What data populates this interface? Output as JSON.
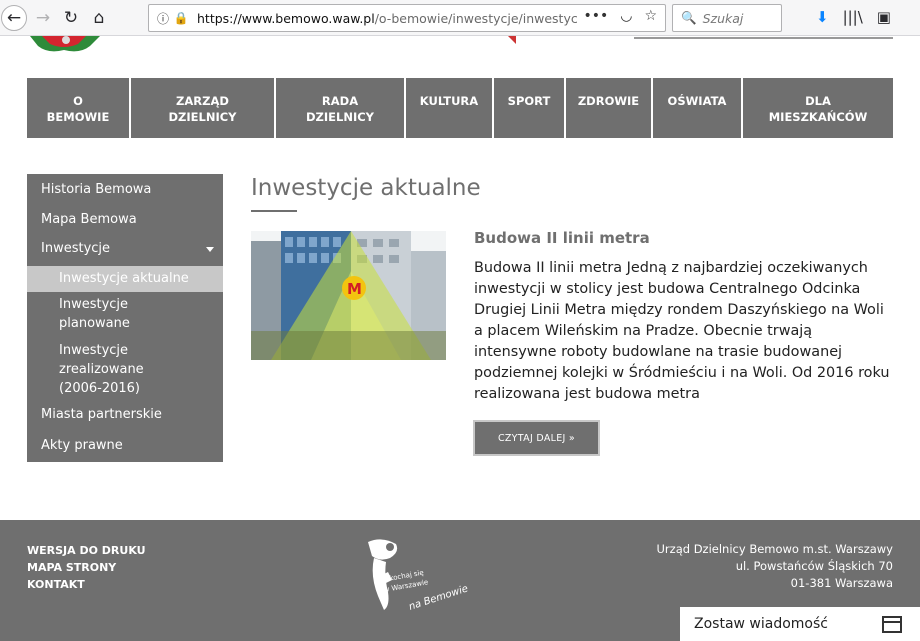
{
  "browser": {
    "url_host": "https://www.bemowo.waw.pl",
    "url_path": "/o-bemowie/inwestycje/inwestycje",
    "search_placeholder": "Szukaj"
  },
  "nav": {
    "items": [
      {
        "line1": "O",
        "line2": "BEMOWIE"
      },
      {
        "line1": "ZARZĄD",
        "line2": "DZIELNICY"
      },
      {
        "line1": "RADA",
        "line2": "DZIELNICY"
      },
      {
        "line1": "KULTURA",
        "line2": ""
      },
      {
        "line1": "SPORT",
        "line2": ""
      },
      {
        "line1": "ZDROWIE",
        "line2": ""
      },
      {
        "line1": "OŚWIATA",
        "line2": ""
      },
      {
        "line1": "DLA",
        "line2": "MIESZKAŃCÓW"
      }
    ]
  },
  "sidebar": {
    "items": [
      {
        "label": "Historia Bemowa"
      },
      {
        "label": "Mapa Bemowa"
      },
      {
        "label": "Inwestycje"
      },
      {
        "label": "Inwestycje aktualne"
      },
      {
        "label": "Inwestycje planowane"
      },
      {
        "label": "Inwestycje zrealizowane (2006-2016)"
      },
      {
        "label": "Miasta partnerskie"
      },
      {
        "label": "Akty prawne"
      }
    ]
  },
  "main": {
    "title": "Inwestycje aktualne",
    "article": {
      "title": "Budowa II linii metra",
      "text": "Budowa II linii metra Jedną z najbardziej oczekiwanych inwestycji w stolicy jest budowa Centralnego Odcinka Drugiej Linii Metra między rondem Daszyńskiego na Woli a placem Wileńskim na Pradze. Obecnie trwają intensywne roboty budowlane na trasie budowanej podziemnej kolejki w Śródmieściu i na Woli. Od 2016 roku realizowana jest budowa metra",
      "more_label": "CZYTAJ DALEJ »"
    }
  },
  "footer": {
    "links": [
      "WERSJA DO DRUKU",
      "MAPA STRONY",
      "KONTAKT"
    ],
    "address": [
      "Urząd Dzielnicy Bemowo m.st. Warszawy",
      "ul. Powstańców Śląskich 70",
      "01-381 Warszawa"
    ],
    "logo_text_1": "zakochaj się",
    "logo_text_2": "w Warszawie",
    "logo_text_3": "na Bemowie"
  },
  "feedback": {
    "label": "Zostaw wiadomość"
  },
  "colors": {
    "gray": "#6f6f6f",
    "active_sub": "#c8c8c8",
    "lock_green": "#12bc00",
    "download_blue": "#0a84ff"
  }
}
